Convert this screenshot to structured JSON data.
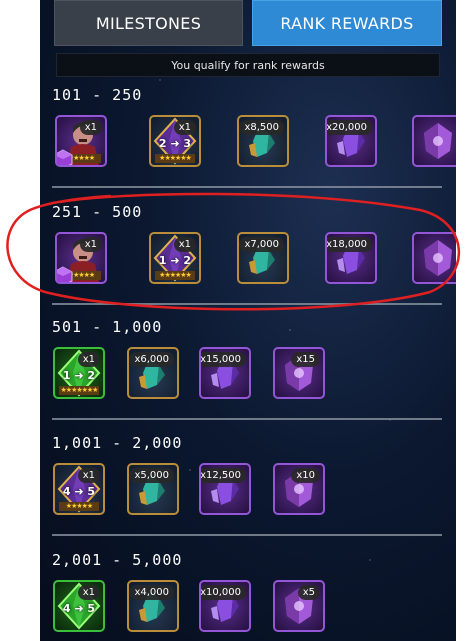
{
  "tabs": {
    "milestones": "MILESTONES",
    "rank_rewards": "RANK REWARDS"
  },
  "status": "You qualify for rank rewards",
  "sections": [
    {
      "title": "101 - 250",
      "rewards": [
        {
          "kind": "champion",
          "qty": "x1",
          "stars": "★★★★★"
        },
        {
          "kind": "rankup",
          "label": "2 ➜ 3",
          "qty": "x1",
          "stars": "★★★★★★"
        },
        {
          "kind": "shard-teal",
          "qty": "x8,500"
        },
        {
          "kind": "shard-purple",
          "qty": "x20,000"
        },
        {
          "kind": "crystal-purple",
          "qty": ""
        }
      ]
    },
    {
      "title": "251 - 500",
      "rewards": [
        {
          "kind": "champion",
          "qty": "x1",
          "stars": "★★★★★"
        },
        {
          "kind": "rankup",
          "label": "1 ➜ 2",
          "qty": "x1",
          "stars": "★★★★★★"
        },
        {
          "kind": "shard-teal",
          "qty": "x7,000"
        },
        {
          "kind": "shard-purple",
          "qty": "x18,000"
        },
        {
          "kind": "crystal-purple",
          "qty": ""
        }
      ]
    },
    {
      "title": "501 - 1,000",
      "rewards": [
        {
          "kind": "rankup-green",
          "label": "1 ➜ 2",
          "qty": "x1",
          "stars": "★★★★★★★"
        },
        {
          "kind": "shard-teal",
          "qty": "x6,000"
        },
        {
          "kind": "shard-purple",
          "qty": "x15,000"
        },
        {
          "kind": "crystal-purple",
          "qty": "x15"
        }
      ]
    },
    {
      "title": "1,001 - 2,000",
      "rewards": [
        {
          "kind": "rankup",
          "label": "4 ➜ 5",
          "qty": "x1",
          "stars": "★★★★★"
        },
        {
          "kind": "shard-teal",
          "qty": "x5,000"
        },
        {
          "kind": "shard-purple",
          "qty": "x12,500"
        },
        {
          "kind": "crystal-purple",
          "qty": "x10"
        }
      ]
    },
    {
      "title": "2,001 - 5,000",
      "rewards": [
        {
          "kind": "rankup-green",
          "label": "4 ➜ 5",
          "qty": "x1",
          "stars": ""
        },
        {
          "kind": "shard-teal",
          "qty": "x4,000"
        },
        {
          "kind": "shard-purple",
          "qty": "x10,000"
        },
        {
          "kind": "crystal-purple",
          "qty": "x5"
        }
      ]
    }
  ],
  "colors": {
    "tab_active": "#2e8ad4",
    "tab_inactive": "#3a4049",
    "annotation": "#e02020"
  }
}
